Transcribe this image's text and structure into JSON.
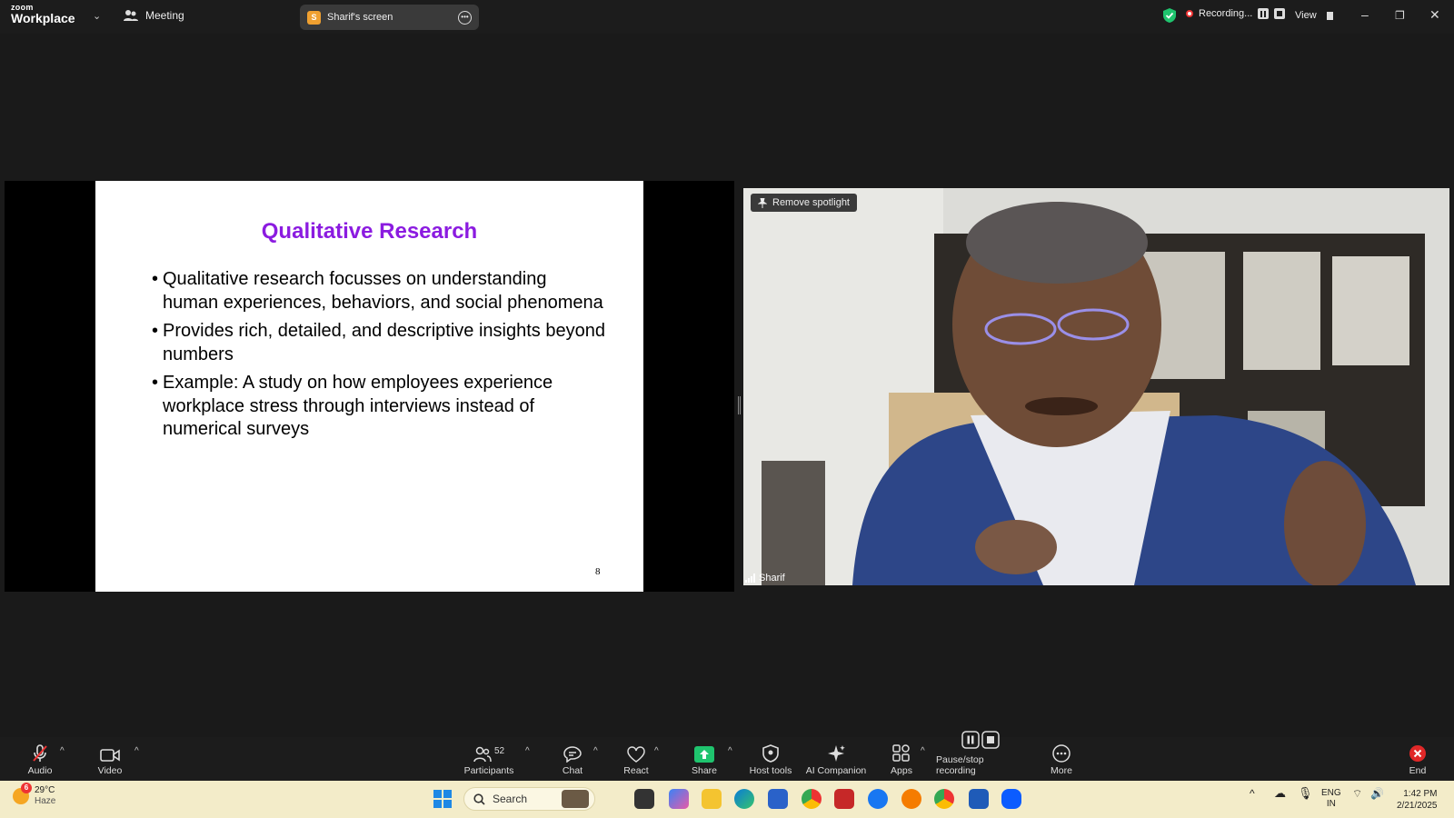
{
  "app": {
    "brand_top": "zoom",
    "brand_bottom": "Workplace"
  },
  "topbar": {
    "meeting_label": "Meeting",
    "screen_share_label": "Sharif's screen",
    "screen_share_initial": "S",
    "recording_label": "Recording...",
    "view_label": "View"
  },
  "slide": {
    "title": "Qualitative Research",
    "bullets": [
      "Qualitative research focusses on understanding human experiences, behaviors, and social phenomena",
      "Provides rich, detailed, and descriptive insights beyond numbers",
      "Example: A study on how employees experience workplace stress through interviews instead of numerical surveys"
    ],
    "page_number": "8"
  },
  "video": {
    "spotlight_button": "Remove spotlight",
    "participant_name": "Sharif"
  },
  "toolbar": {
    "audio": "Audio",
    "video": "Video",
    "participants": "Participants",
    "participants_count": "52",
    "chat": "Chat",
    "react": "React",
    "share": "Share",
    "host_tools": "Host tools",
    "ai_companion": "AI Companion",
    "apps": "Apps",
    "pause_stop": "Pause/stop recording",
    "more": "More",
    "end": "End"
  },
  "taskbar": {
    "weather_temp": "29°C",
    "weather_desc": "Haze",
    "weather_badge": "6",
    "search_placeholder": "Search",
    "lang_top": "ENG",
    "lang_bottom": "IN",
    "time": "1:42 PM",
    "date": "2/21/2025"
  },
  "colors": {
    "slide_title": "#8b1be0",
    "share_green": "#1fc46e",
    "end_red": "#e02828",
    "taskbar_bg": "#f3ecc9"
  }
}
